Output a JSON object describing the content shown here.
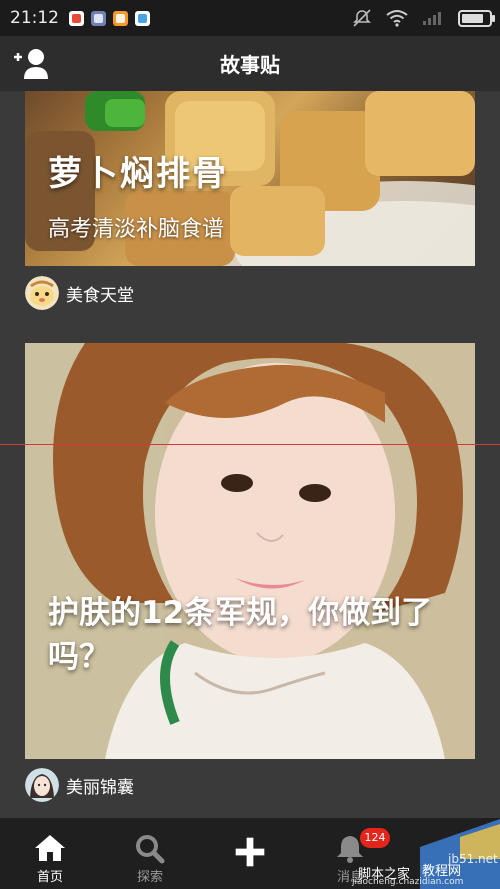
{
  "status_bar": {
    "time": "21:12"
  },
  "header": {
    "title": "故事贴"
  },
  "feed": [
    {
      "title": "萝卜焖排骨",
      "subtitle": "高考清淡补脑食谱",
      "author": "美食天堂"
    },
    {
      "title": "护肤的12条军规，你做到了吗？",
      "author": "美丽锦囊"
    }
  ],
  "tabbar": {
    "tabs": [
      {
        "label": "首页"
      },
      {
        "label": "探索"
      },
      {
        "label": ""
      },
      {
        "label": "消息",
        "badge": "124"
      }
    ]
  },
  "watermark": {
    "line1": "jb51.net",
    "line2": "脚本之家",
    "line3": "jiaocheng.chazidian.com",
    "line4": "教程网"
  }
}
